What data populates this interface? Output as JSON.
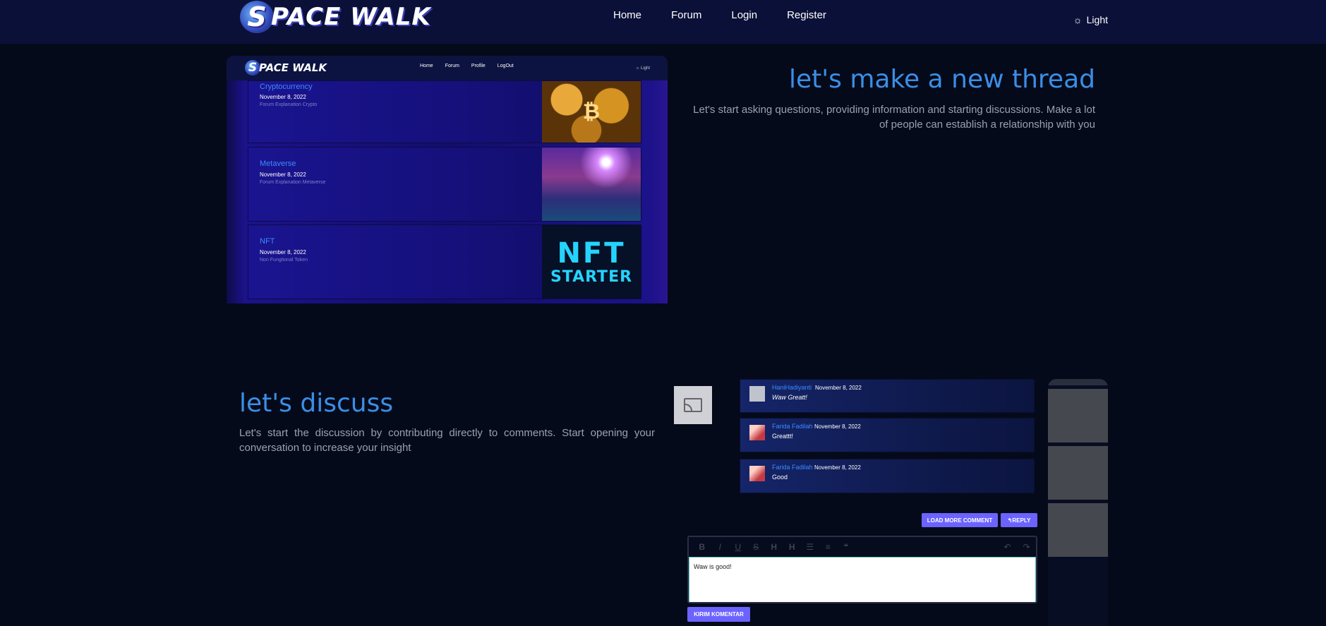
{
  "navbar": {
    "logo_letter": "S",
    "logo_text": "PACE WALK",
    "links": [
      "Home",
      "Forum",
      "Login",
      "Register"
    ],
    "theme_icon": "sun-icon",
    "theme_label": "Light"
  },
  "section1": {
    "title": "let's make a new thread",
    "text": "Let's start asking questions, providing information and starting discussions. Make a lot of people can establish a relationship with you",
    "screenshot": {
      "logo_letter": "S",
      "logo_text": "PACE WALK",
      "nav_links": [
        "Home",
        "Forum",
        "Profile",
        "LogOut"
      ],
      "theme_label": "☼ Light",
      "threads": [
        {
          "title": "Cryptocurrency",
          "date": "November 8, 2022",
          "desc": "Forum Explanation Crypto"
        },
        {
          "title": "Metaverse",
          "date": "November 8, 2022",
          "desc": "Forum Explanation Metaverse"
        },
        {
          "title": "NFT",
          "date": "November 8, 2022",
          "desc": "Non Fungtional Token"
        }
      ],
      "nft_line1": "NFT",
      "nft_line2": "STARTER"
    }
  },
  "section2": {
    "title": "let's discuss",
    "text": "Let's start the discussion by contributing directly to comments. Start opening your conversation to increase your insight",
    "screenshot": {
      "comments": [
        {
          "name": "HaniHadiyanti",
          "date": "November 8, 2022",
          "body": "Waw Greatt!"
        },
        {
          "name": "Farida Fadilah",
          "date": "November 8, 2022",
          "body": "Greattt!"
        },
        {
          "name": "Farida Fadilah",
          "date": "November 8, 2022",
          "body": "Good"
        }
      ],
      "load_more_label": "LOAD MORE COMMENT",
      "reply_label": "↰REPLY",
      "editor_text": "Waw is good!",
      "submit_label": "KIRIM KOMENTAR"
    }
  }
}
